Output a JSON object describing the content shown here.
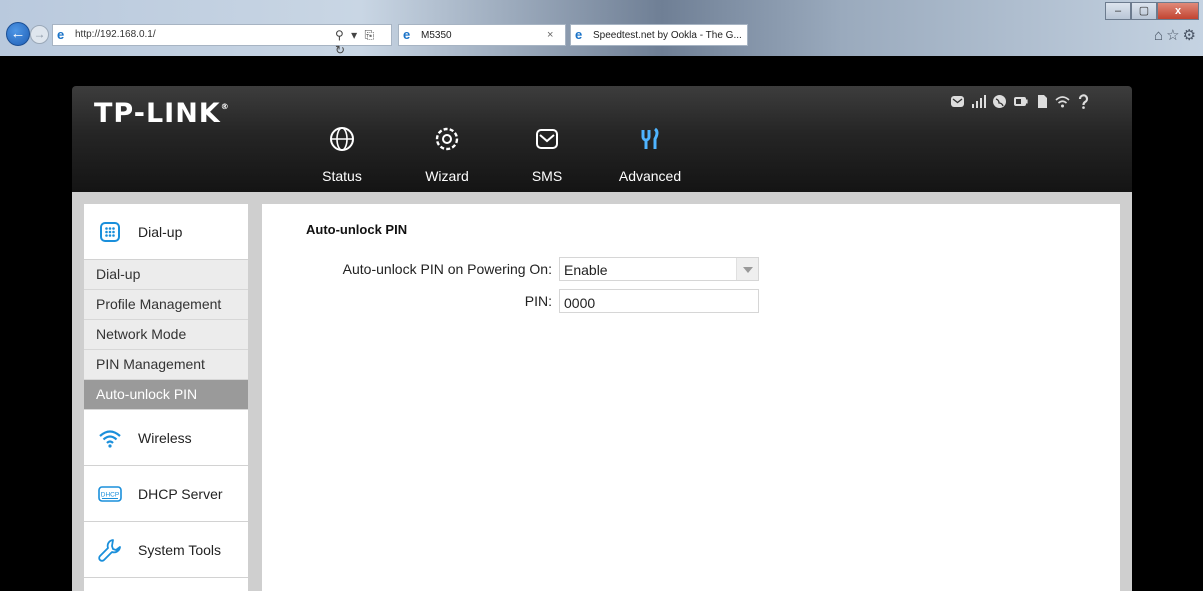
{
  "browser": {
    "url": "http://192.168.0.1/",
    "tabs": [
      {
        "label": "M5350"
      },
      {
        "label": "Speedtest.net by Ookla - The G..."
      }
    ],
    "tab_close_glyph": "×",
    "win_controls": [
      "–",
      "▢",
      "x"
    ]
  },
  "app": {
    "logo": "TP-LINK",
    "logo_mark": "®"
  },
  "nav": [
    {
      "label": "Status",
      "icon": "globe-icon"
    },
    {
      "label": "Wizard",
      "icon": "wizard-gear-icon"
    },
    {
      "label": "SMS",
      "icon": "message-icon"
    },
    {
      "label": "Advanced",
      "icon": "tools-icon",
      "active": true
    }
  ],
  "status_icons": [
    "sms-icon",
    "signal-icon",
    "internet-icon",
    "battery-icon",
    "sim-card-icon",
    "wifi-icon",
    "help-icon"
  ],
  "sidebar": {
    "sections": [
      {
        "label": "Dial-up",
        "icon": "dialpad-icon",
        "expanded": true
      },
      {
        "label": "Wireless",
        "icon": "wifi-icon"
      },
      {
        "label": "DHCP Server",
        "icon": "dhcp-icon"
      },
      {
        "label": "System Tools",
        "icon": "wrench-icon"
      }
    ],
    "subitems": [
      "Dial-up",
      "Profile Management",
      "Network Mode",
      "PIN Management",
      "Auto-unlock PIN"
    ],
    "active_subitem": "Auto-unlock PIN"
  },
  "panel": {
    "title": "Auto-unlock PIN",
    "unlock_label": "Auto-unlock PIN on Powering On:",
    "unlock_value": "Enable",
    "pin_label": "PIN:",
    "pin_value": "0000"
  },
  "colors": {
    "header_dark": "#1b1b1b",
    "active_subitem_bg": "#9a9a9a",
    "advanced_icon": "#4fb4ff"
  }
}
